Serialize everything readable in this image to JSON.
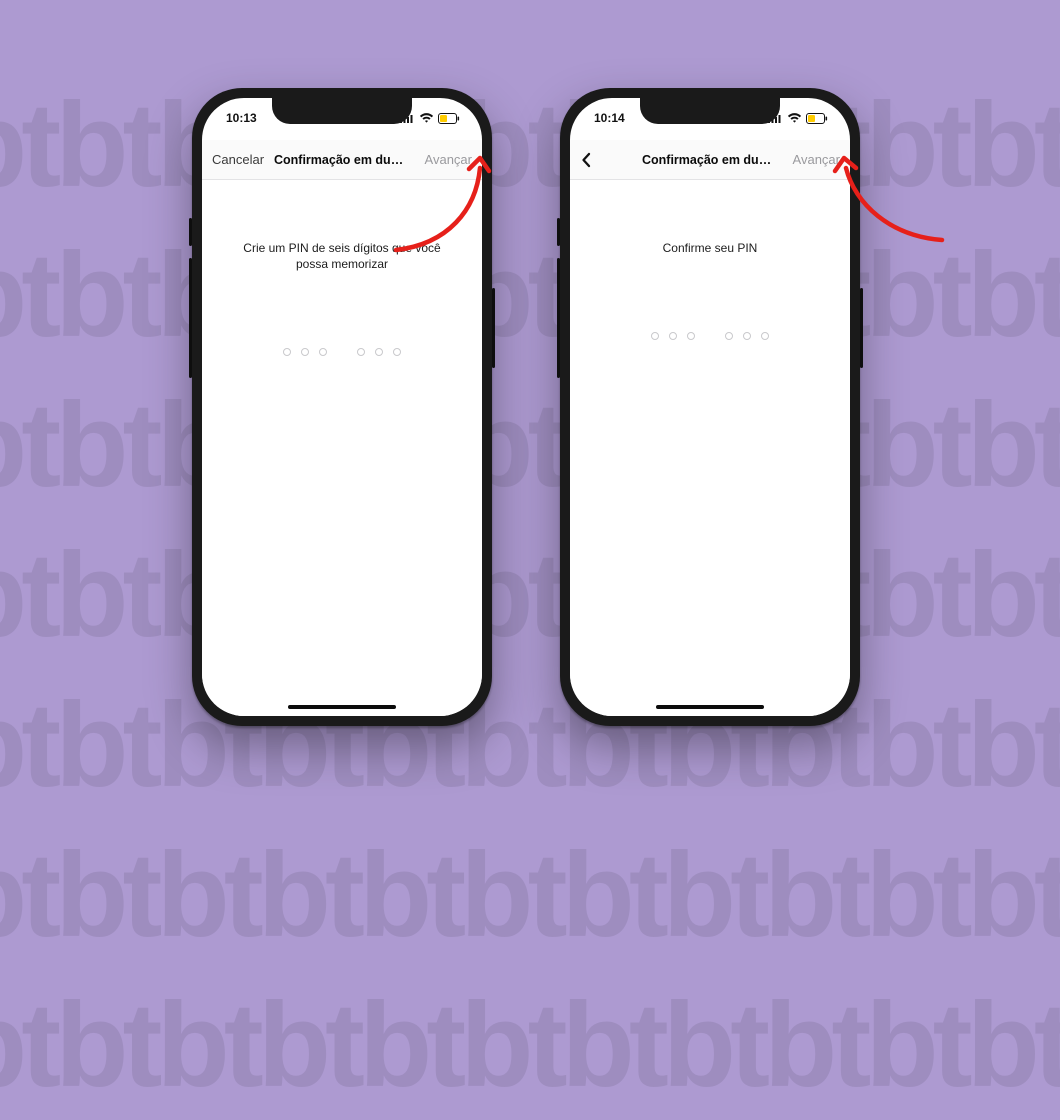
{
  "background": {
    "color": "#ad9ad1"
  },
  "phones": [
    {
      "status": {
        "time": "10:13"
      },
      "nav": {
        "left_kind": "text",
        "left_label": "Cancelar",
        "title": "Confirmação em duas etap...",
        "right_label": "Avançar"
      },
      "instruction": "Crie um PIN de seis dígitos que você possa memorizar"
    },
    {
      "status": {
        "time": "10:14"
      },
      "nav": {
        "left_kind": "back",
        "left_label": "",
        "title": "Confirmação em duas etapas",
        "right_label": "Avançar"
      },
      "instruction": "Confirme seu PIN"
    }
  ],
  "annotation": {
    "color": "#e6201a",
    "targets": [
      "nav-next-button",
      "nav-next-button"
    ]
  }
}
